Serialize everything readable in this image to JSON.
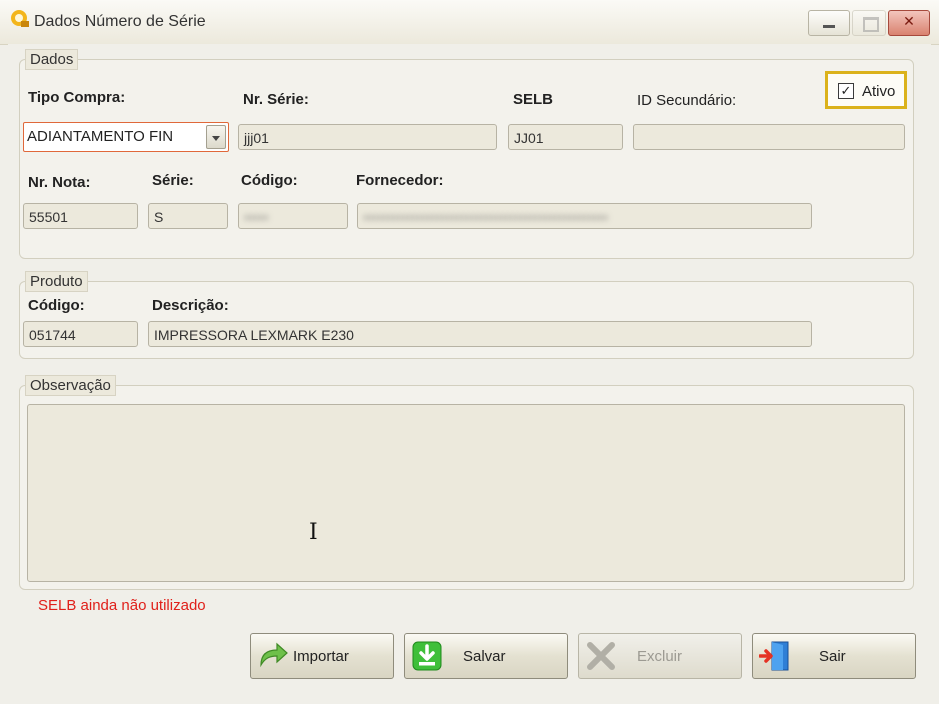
{
  "window": {
    "title": "Dados Número de Série"
  },
  "dados": {
    "group_label": "Dados",
    "tipo_compra_label": "Tipo Compra:",
    "tipo_compra_value": "ADIANTAMENTO FIN",
    "nr_serie_label": "Nr. Série:",
    "nr_serie_value": "jjj01",
    "selb_label": "SELB",
    "selb_value": "JJ01",
    "id_secundario_label": "ID Secundário:",
    "id_secundario_value": "",
    "ativo_label": "Ativo",
    "ativo_checked": true,
    "nr_nota_label": "Nr. Nota:",
    "nr_nota_value": "55501",
    "serie_label": "Série:",
    "serie_value": "S",
    "codigo_label": "Código:",
    "codigo_value": "•••••",
    "fornecedor_label": "Fornecedor:",
    "fornecedor_value": "••••••••••••••••••••••••••••••••••••••••••••••••••"
  },
  "produto": {
    "group_label": "Produto",
    "codigo_label": "Código:",
    "codigo_value": "051744",
    "descricao_label": "Descrição:",
    "descricao_value": "IMPRESSORA LEXMARK E230"
  },
  "observacao": {
    "group_label": "Observação",
    "value": ""
  },
  "status_message": "SELB ainda não utilizado",
  "buttons": {
    "importar": "Importar",
    "salvar": "Salvar",
    "excluir": "Excluir",
    "sair": "Sair"
  },
  "colors": {
    "status_error": "#e0201a",
    "ativo_highlight": "#dbb21b",
    "combo_focus": "#e0683a"
  }
}
